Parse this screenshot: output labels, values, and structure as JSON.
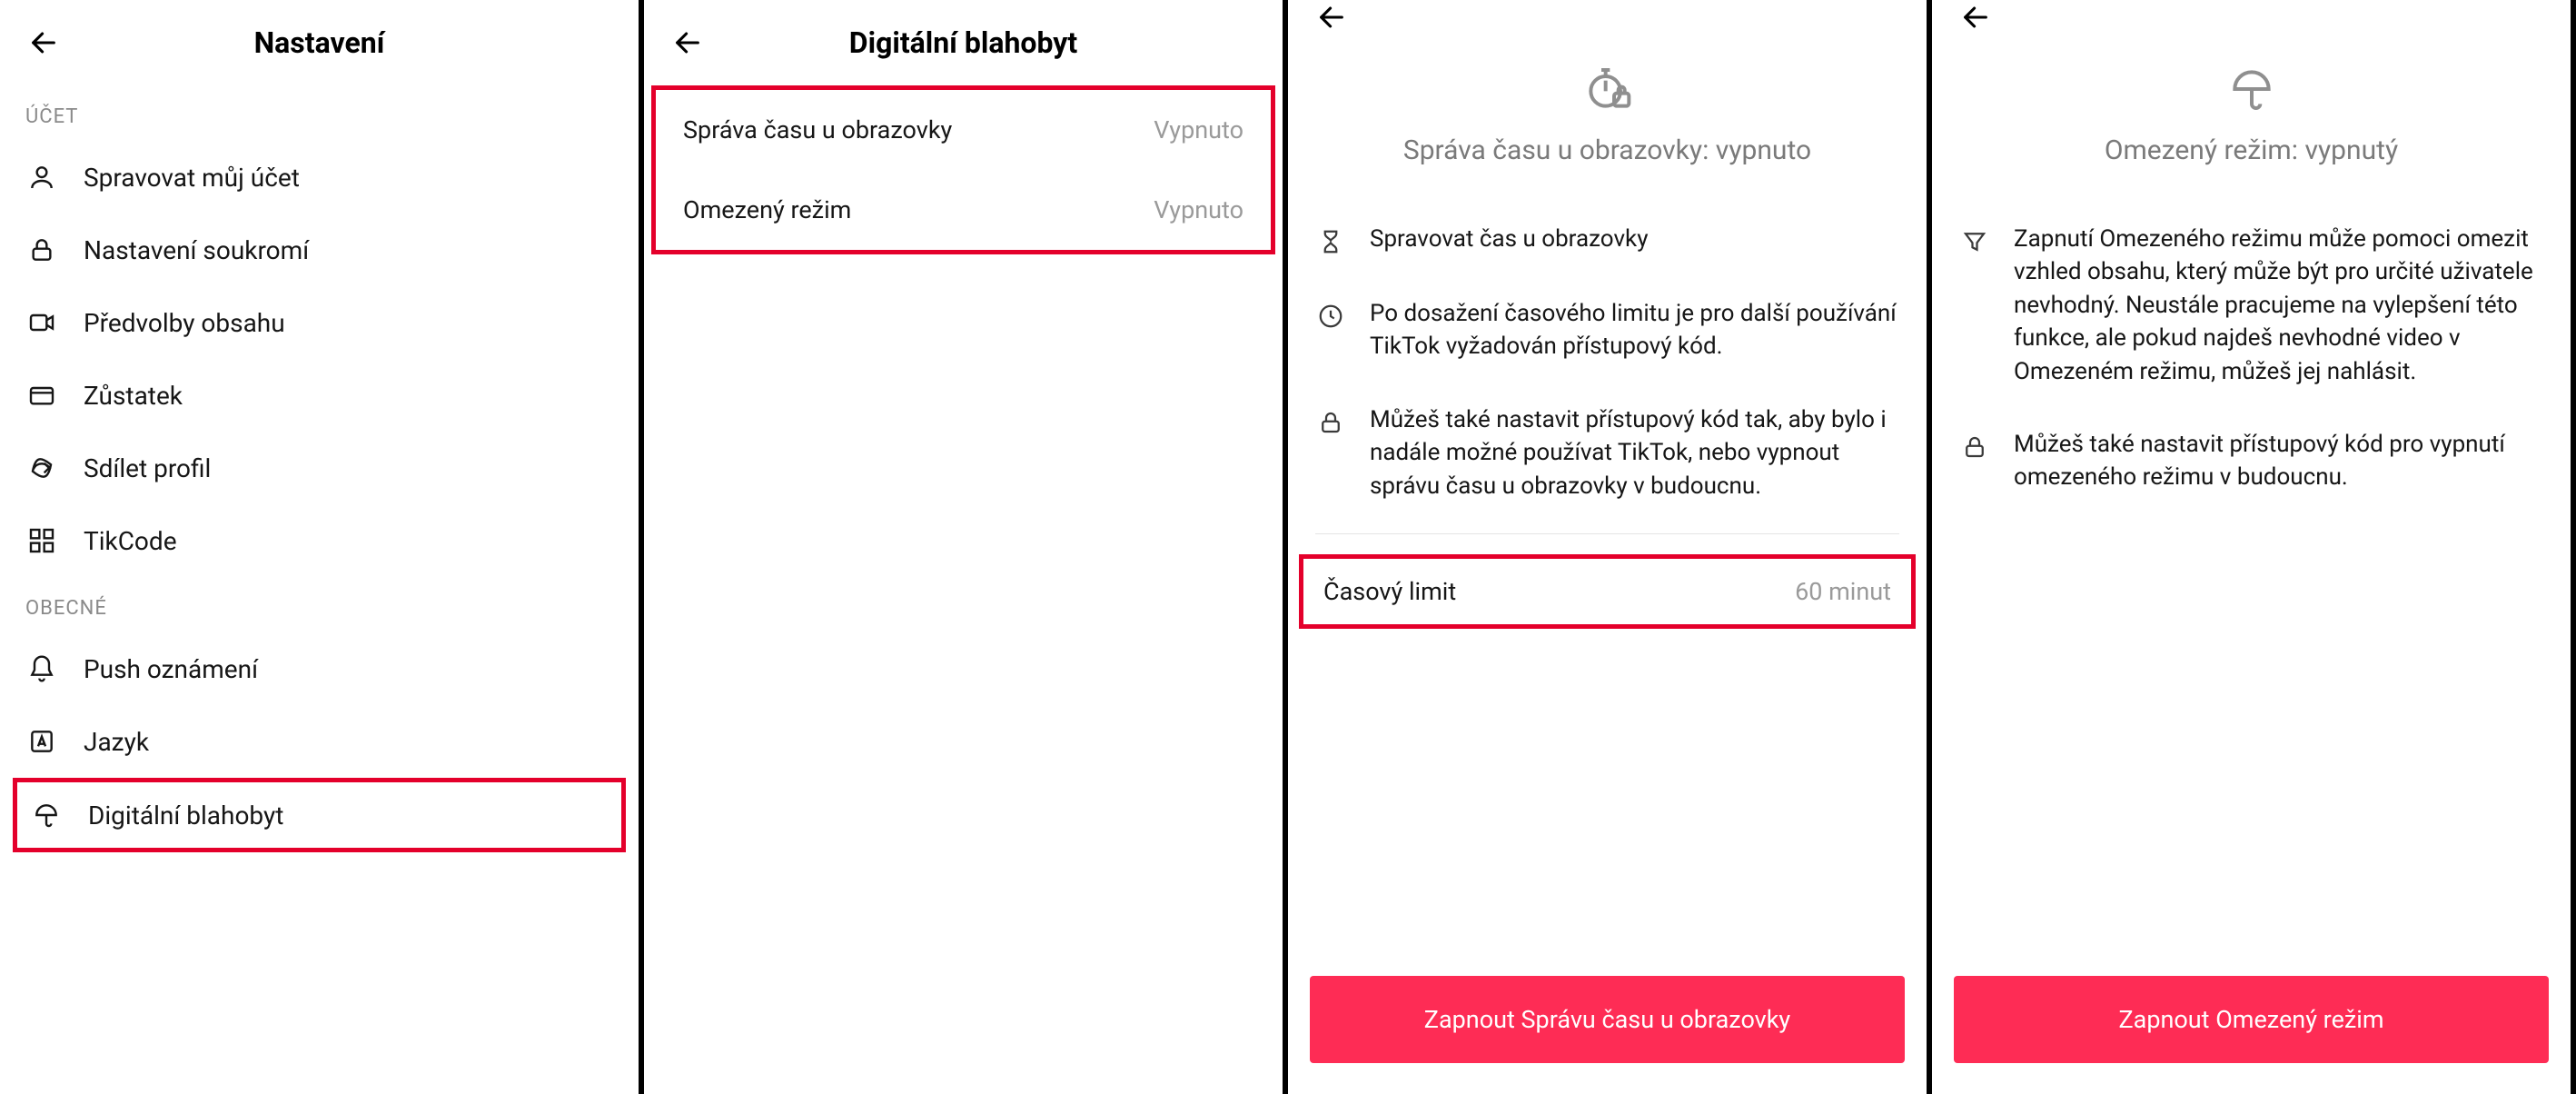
{
  "panel1": {
    "title": "Nastavení",
    "section_account": "ÚČET",
    "items_account": [
      {
        "label": "Spravovat můj účet"
      },
      {
        "label": "Nastavení soukromí"
      },
      {
        "label": "Předvolby obsahu"
      },
      {
        "label": "Zůstatek"
      },
      {
        "label": "Sdílet profil"
      },
      {
        "label": "TikCode"
      }
    ],
    "section_general": "OBECNÉ",
    "items_general": [
      {
        "label": "Push oznámení"
      },
      {
        "label": "Jazyk"
      },
      {
        "label": "Digitální blahobyt"
      }
    ]
  },
  "panel2": {
    "title": "Digitální blahobyt",
    "rows": [
      {
        "label": "Správa času u obrazovky",
        "value": "Vypnuto"
      },
      {
        "label": "Omezený režim",
        "value": "Vypnuto"
      }
    ]
  },
  "panel3": {
    "hero_title": "Správa času u obrazovky: vypnuto",
    "info": [
      "Spravovat čas u obrazovky",
      "Po dosažení časového limitu je pro další používání TikTok vyžadován přístupový kód.",
      "Můžeš také nastavit přístupový kód tak, aby bylo i nadále možné používat TikTok, nebo vypnout správu času u obrazovky v budoucnu."
    ],
    "time_limit_label": "Časový limit",
    "time_limit_value": "60 minut",
    "button": "Zapnout Správu času u obrazovky"
  },
  "panel4": {
    "hero_title": "Omezený režim: vypnutý",
    "info": [
      "Zapnutí Omezeného režimu může pomoci omezit vzhled obsahu, který může být pro určité uživatele nevhodný. Neustále pracujeme na vylepšení této funkce, ale pokud najdeš nevhodné video v Omezeném režimu, můžeš jej nahlásit.",
      "Můžeš také nastavit přístupový kód pro vypnutí omezeného režimu v budoucnu."
    ],
    "button": "Zapnout Omezený režim"
  }
}
